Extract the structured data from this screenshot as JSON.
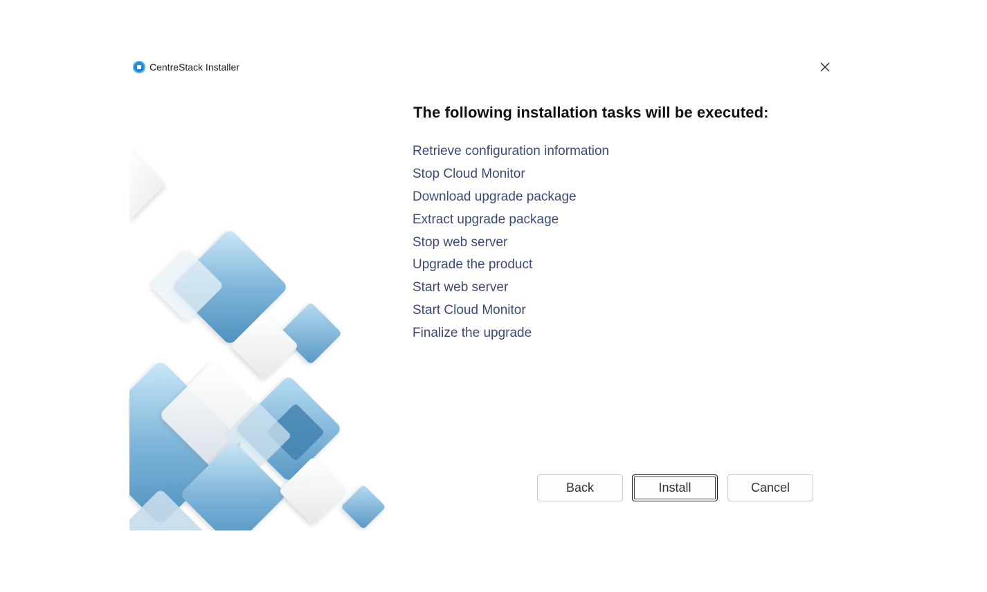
{
  "window": {
    "title": "CentreStack Installer",
    "close_icon": "close-icon"
  },
  "content": {
    "heading": "The following installation tasks will be executed:",
    "tasks": [
      "Retrieve configuration information",
      "Stop Cloud Monitor",
      "Download upgrade package",
      "Extract upgrade package",
      "Stop web server",
      "Upgrade the product",
      "Start web server",
      "Start Cloud Monitor",
      "Finalize the upgrade"
    ]
  },
  "buttons": {
    "back": "Back",
    "install": "Install",
    "cancel": "Cancel"
  },
  "colors": {
    "brand": "#1e88d6",
    "task_text": "#3c4a78",
    "art_blue": "#5b9ec8"
  }
}
